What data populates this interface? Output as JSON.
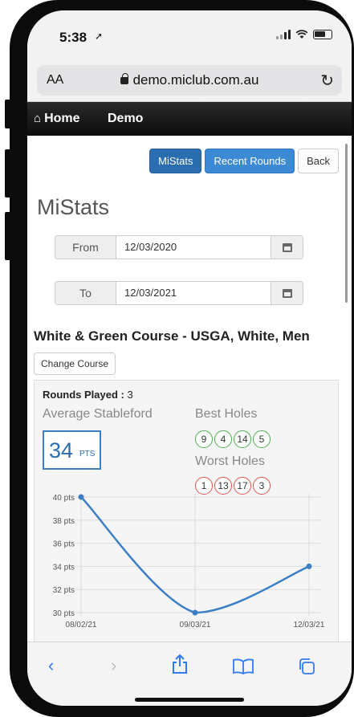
{
  "status_bar": {
    "time": "5:38"
  },
  "browser": {
    "aa_label": "AA",
    "url": "demo.miclub.com.au"
  },
  "nav": {
    "home": "Home",
    "demo": "Demo"
  },
  "actions": {
    "mistats": "MiStats",
    "recent_rounds": "Recent Rounds",
    "back": "Back"
  },
  "page": {
    "title": "MiStats"
  },
  "dates": {
    "from_label": "From",
    "from_value": "12/03/2020",
    "to_label": "To",
    "to_value": "12/03/2021"
  },
  "course": {
    "title": "White & Green Course - USGA, White, Men",
    "change_button": "Change Course"
  },
  "stats": {
    "rounds_label": "Rounds Played :",
    "rounds_value": "3",
    "avg_label": "Average Stableford",
    "avg_value": "34",
    "avg_unit": "PTS",
    "best_label": "Best Holes",
    "best_holes": [
      "9",
      "4",
      "14",
      "5"
    ],
    "worst_label": "Worst Holes",
    "worst_holes": [
      "1",
      "13",
      "17",
      "3"
    ]
  },
  "colors": {
    "primary": "#2a6db0",
    "info": "#3c8ad6",
    "best": "#4caf50",
    "worst": "#d9534f",
    "line": "#3d7fc4",
    "ios_blue": "#2f7bf6"
  },
  "toolbar": {
    "icons": [
      "back-icon",
      "forward-icon",
      "share-icon",
      "bookmarks-icon",
      "tabs-icon"
    ]
  },
  "chart_data": {
    "type": "line",
    "x": [
      "08/02/21",
      "09/03/21",
      "12/03/21"
    ],
    "series": [
      {
        "values": [
          40,
          30,
          34
        ]
      }
    ],
    "y_ticks": [
      "30 pts",
      "32 pts",
      "34 pts",
      "36 pts",
      "38 pts",
      "40 pts"
    ],
    "ylim": [
      30,
      40
    ],
    "grid": true
  }
}
